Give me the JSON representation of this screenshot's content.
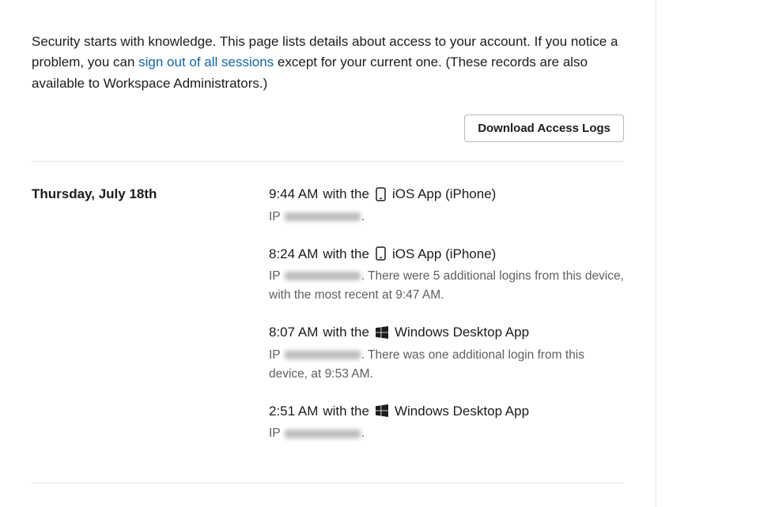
{
  "intro": {
    "pre_link": "Security starts with knowledge. This page lists details about access to your account. If you notice a problem, you can ",
    "link_text": "sign out of all sessions",
    "post_link": " except for your current one. (These records are also available to Workspace Administrators.)"
  },
  "download_button_label": "Download Access Logs",
  "day": {
    "label": "Thursday, July 18th",
    "entries": [
      {
        "time": "9:44 AM",
        "with_the": "with the",
        "platform_icon": "mobile",
        "platform_name": "iOS App (iPhone)",
        "ip_prefix": "IP",
        "extra": "."
      },
      {
        "time": "8:24 AM",
        "with_the": "with the",
        "platform_icon": "mobile",
        "platform_name": "iOS App (iPhone)",
        "ip_prefix": "IP",
        "extra": ". There were 5 additional logins from this device, with the most recent at 9:47 AM."
      },
      {
        "time": "8:07 AM",
        "with_the": "with the",
        "platform_icon": "windows",
        "platform_name": "Windows Desktop App",
        "ip_prefix": "IP",
        "extra": ". There was one additional login from this device, at 9:53 AM."
      },
      {
        "time": "2:51 AM",
        "with_the": "with the",
        "platform_icon": "windows",
        "platform_name": "Windows Desktop App",
        "ip_prefix": "IP",
        "extra": "."
      }
    ]
  }
}
